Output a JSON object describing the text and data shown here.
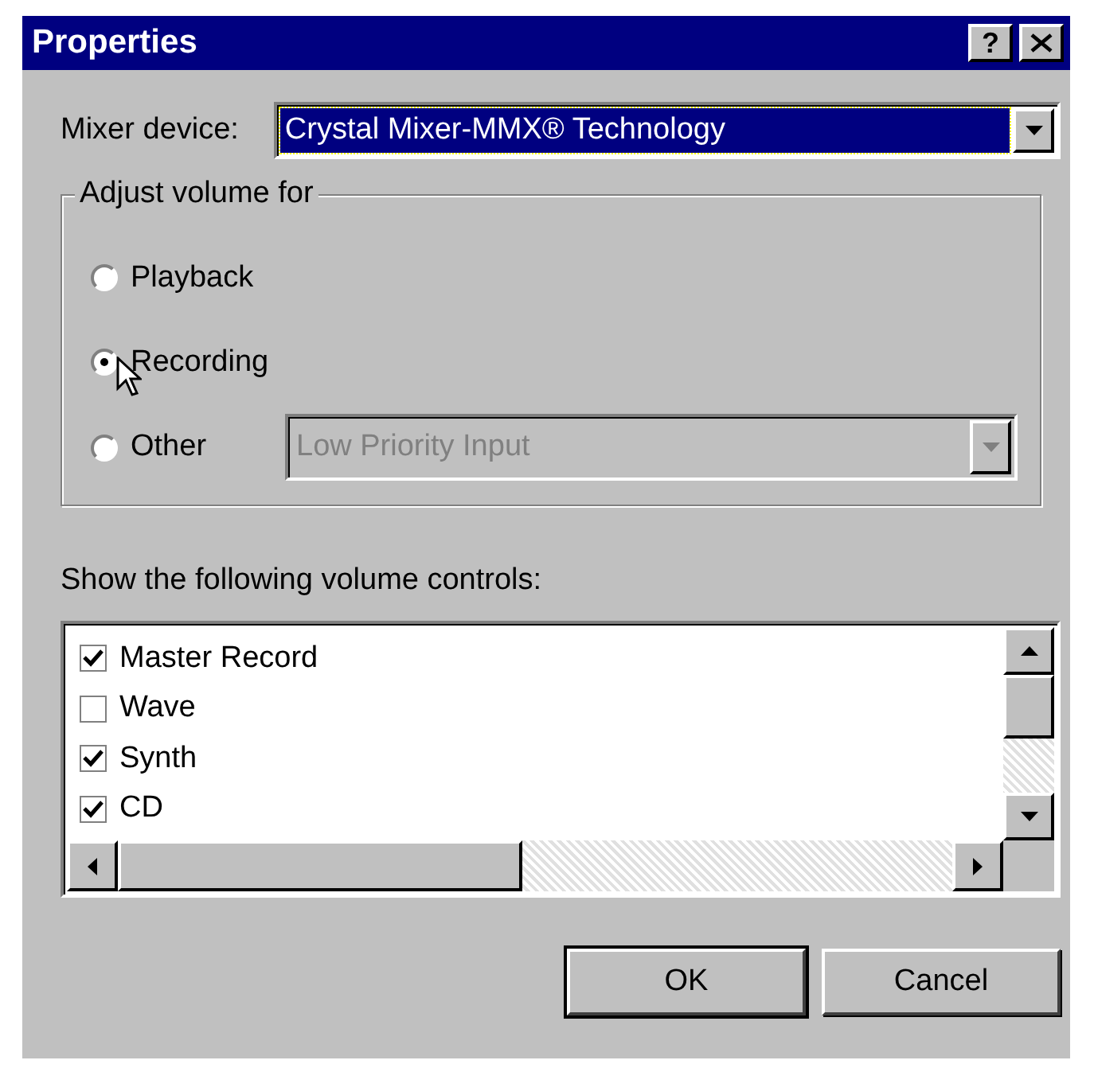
{
  "window": {
    "title": "Properties",
    "help_button": "?"
  },
  "mixer_device": {
    "label": "Mixer device:",
    "value": "Crystal Mixer-MMX® Technology"
  },
  "adjust_volume_for": {
    "title": "Adjust volume for",
    "options": [
      {
        "label": "Playback",
        "selected": false
      },
      {
        "label": "Recording",
        "selected": true
      },
      {
        "label": "Other",
        "selected": false
      }
    ],
    "other_device": {
      "value": "Low Priority Input",
      "disabled": true
    }
  },
  "volume_controls": {
    "label": "Show the following volume controls:",
    "items": [
      {
        "label": "Master Record",
        "checked": true
      },
      {
        "label": "Wave",
        "checked": false
      },
      {
        "label": "Synth",
        "checked": true
      },
      {
        "label": "CD",
        "checked": true
      }
    ]
  },
  "buttons": [
    {
      "label": "OK",
      "default": true
    },
    {
      "label": "Cancel",
      "default": false
    }
  ]
}
